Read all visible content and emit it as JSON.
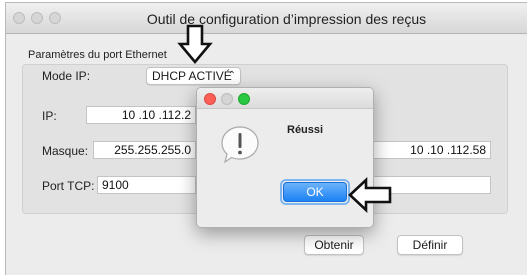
{
  "window": {
    "title": "Outil de configuration d’impression des reçus"
  },
  "ethernet": {
    "section_label": "Paramètres du port Ethernet",
    "mode_label": "Mode IP:",
    "mode_value": "DHCP ACTIVÉ",
    "ip_label": "IP:",
    "ip_value": "10 .10 .112.2",
    "mask_label": "Masque:",
    "mask_value": "255.255.255.0",
    "gateway_value": "10 .10 .112.58",
    "tcp_label": "Port TCP:",
    "tcp_value": "9100"
  },
  "buttons": {
    "obtain_label": "Obtenir",
    "define_label": "Définir"
  },
  "dialog": {
    "message": "Réussi",
    "ok_label": "OK"
  },
  "colors": {
    "accent": "#1d82f5",
    "dialog_close": "#fc5f57",
    "dialog_minimize": "#fdbc2e",
    "dialog_zoom": "#29c840"
  }
}
